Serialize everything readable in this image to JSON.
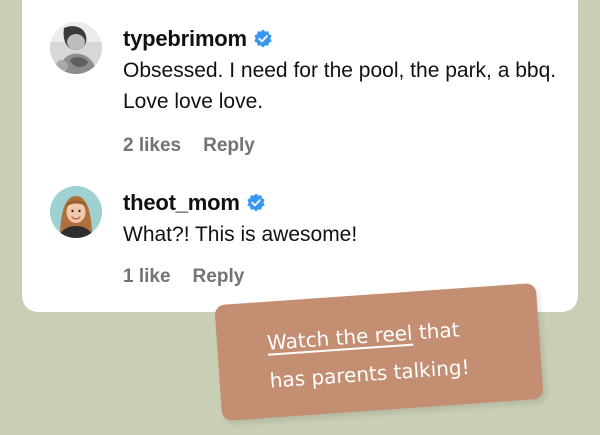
{
  "comments": [
    {
      "username": "typebrimom",
      "verified": true,
      "text": "Obsessed. I need for the pool, the park, a bbq. Love love love.",
      "likes": "2 likes",
      "reply": "Reply",
      "avatar_icon": "baby-photo-avatar"
    },
    {
      "username": "theot_mom",
      "verified": true,
      "text": "What?! This is awesome!",
      "likes": "1 like",
      "reply": "Reply",
      "avatar_icon": "woman-photo-avatar"
    }
  ],
  "cta": {
    "link_text": "Watch the reel",
    "line1_rest": " that",
    "line2": "has parents talking!"
  },
  "colors": {
    "background": "#c9cfb4",
    "card": "#ffffff",
    "verified_blue": "#3897f0",
    "meta_gray": "#737373",
    "cta_bg": "#c38e72"
  }
}
